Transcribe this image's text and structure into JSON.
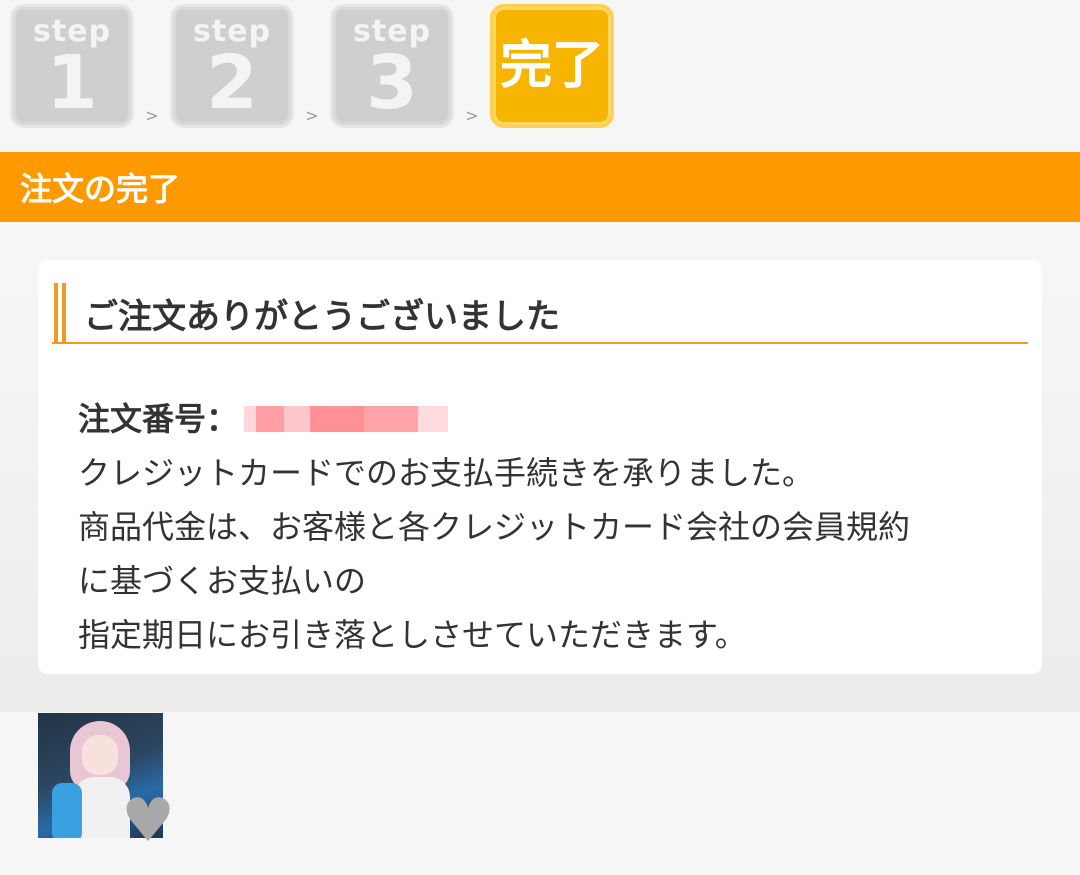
{
  "steps": [
    {
      "word": "step",
      "num": "1"
    },
    {
      "word": "step",
      "num": "2"
    },
    {
      "word": "step",
      "num": "3"
    },
    {
      "label": "完了"
    }
  ],
  "step_separator": ">",
  "section": {
    "title": "注文の完了"
  },
  "card": {
    "heading": "ご注文ありがとうございました",
    "order_label": "注文番号：",
    "lines": [
      "クレジットカードでのお支払手続きを承りました。",
      "商品代金は、お客様と各クレジットカード会社の会員規約",
      "に基づくお支払いの",
      "指定期日にお引き落としさせていただきます。"
    ]
  },
  "thumbnail": {
    "favorite_icon": "heart-icon"
  },
  "colors": {
    "accent": "#ff9900",
    "step_active": "#f7b500",
    "step_inactive": "#cfcfcf"
  }
}
